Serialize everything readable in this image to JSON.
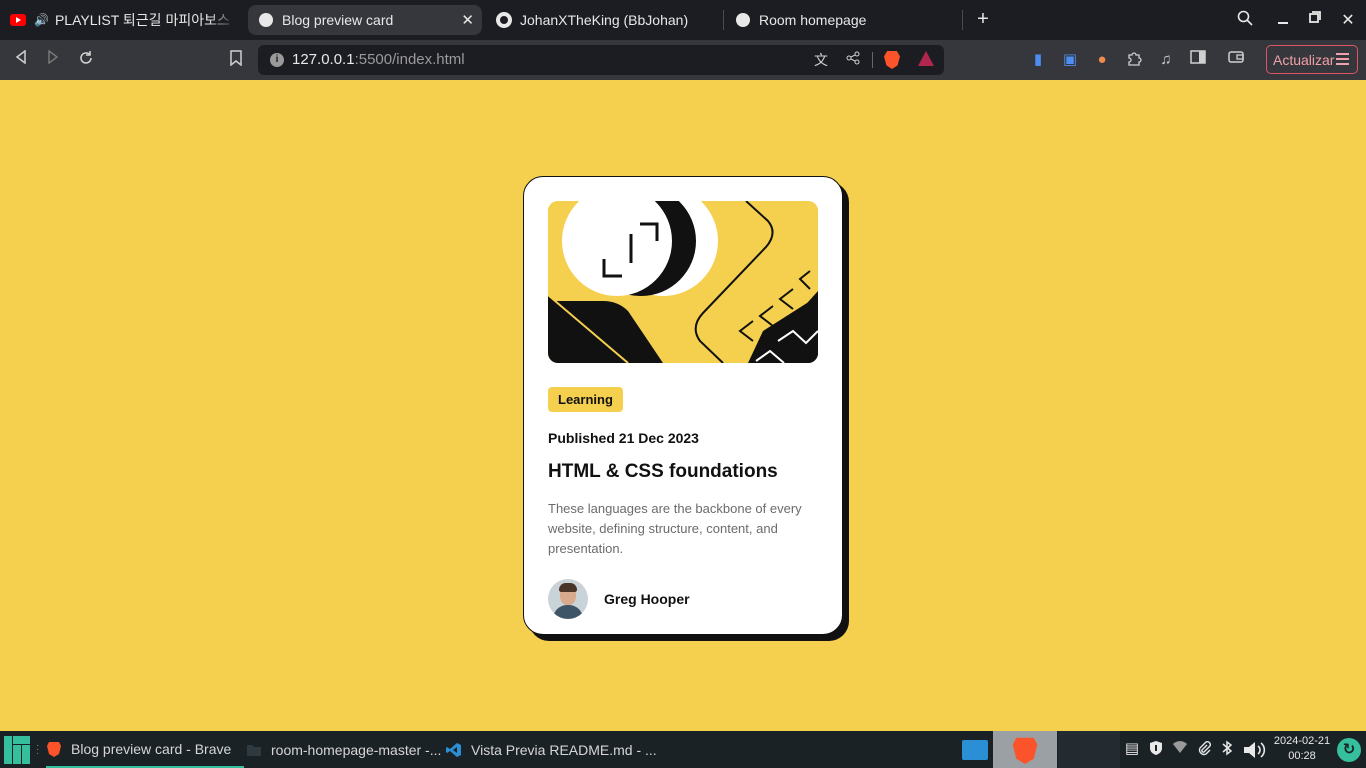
{
  "browser": {
    "tabs": [
      {
        "label": "PLAYLIST 퇴근길 마피아보스",
        "icon": "youtube-icon",
        "audio": true
      },
      {
        "label": "Blog preview card",
        "icon": "globe-icon",
        "active": true
      },
      {
        "label": "JohanXTheKing (BbJohan)",
        "icon": "github-icon"
      },
      {
        "label": "Room homepage",
        "icon": "globe-icon"
      }
    ],
    "url_host": "127.0.0.1",
    "url_rest": ":5500/index.html",
    "update_label": "Actualizar"
  },
  "card": {
    "tag": "Learning",
    "published": "Published 21 Dec 2023",
    "title": "HTML & CSS foundations",
    "description": "These languages are the backbone of every website, defining structure, content, and presentation.",
    "author": "Greg Hooper"
  },
  "taskbar": {
    "items": [
      {
        "label": "Blog preview card - Brave",
        "icon": "brave-icon",
        "active": true
      },
      {
        "label": "room-homepage-master -...",
        "icon": "folder-icon"
      },
      {
        "label": "Vista Previa README.md - ...",
        "icon": "vscode-icon"
      }
    ],
    "date": "2024-02-21",
    "time": "00:28"
  },
  "colors": {
    "page_bg": "#f4d04e",
    "card_bg": "#ffffff",
    "text_dark": "#111111",
    "text_muted": "#6b6b6b",
    "accent_green": "#35bf9c",
    "update_red": "#e05563"
  }
}
